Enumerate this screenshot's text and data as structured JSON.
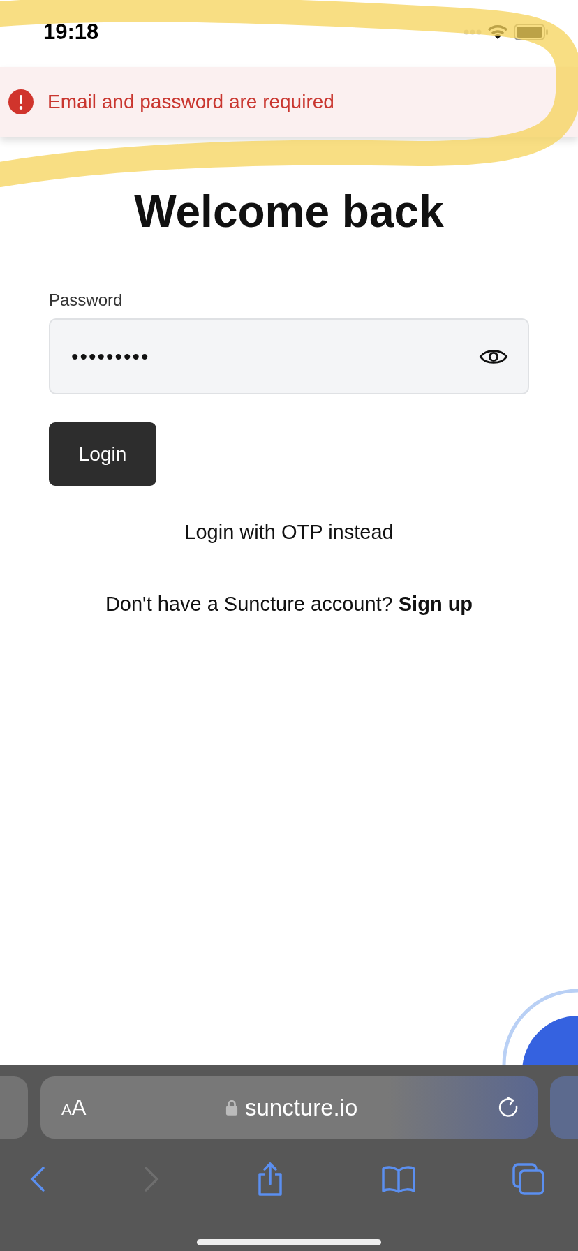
{
  "status_bar": {
    "time": "19:18"
  },
  "toast": {
    "kind": "error",
    "message": "Email and password are required"
  },
  "heading": "Welcome back",
  "password_field": {
    "label": "Password",
    "value": "•••••••••"
  },
  "login_button": "Login",
  "otp_link": "Login with OTP instead",
  "signup": {
    "prompt": "Don't have a Suncture account?",
    "link": "Sign up"
  },
  "browser": {
    "text_size": "AA",
    "url": "suncture.io",
    "back_disabled": false,
    "forward_disabled": true
  }
}
